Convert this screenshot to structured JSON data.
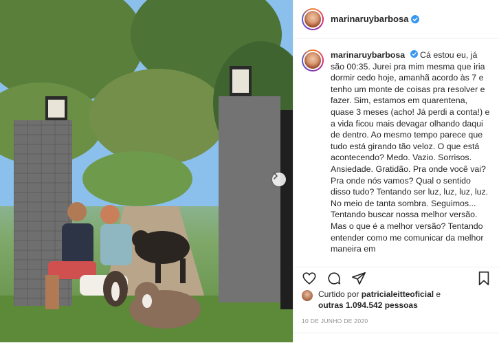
{
  "post": {
    "username": "marinaruybarbosa",
    "caption": "Cá estou eu, já são 00:35. Jurei pra mim mesma que iria dormir cedo hoje, amanhã acordo às 7 e tenho um monte de coisas pra resolver e fazer. Sim, estamos em quarentena, quase 3 meses (acho! Já perdi a conta!) e a vida ficou mais devagar olhando daqui de dentro. Ao mesmo tempo parece que tudo está girando tão veloz. O que está acontecendo? Medo. Vazio. Sorrisos. Ansiedade. Gratidão. Pra onde você vai? Pra onde nós vamos? Qual o sentido disso tudo? Tentando ser luz, luz, luz, luz. No meio de tanta sombra. Seguimos... Tentando buscar nossa melhor versão. Mas o que é a melhor versão? Tentando entender como me comunicar da melhor maneira em",
    "likes_prefix": "Curtido por ",
    "likes_user": "patricialeitteoficial",
    "likes_mid": " e",
    "likes_others": "outras 1.094.542 pessoas",
    "date": "10 DE JUNHO DE 2020"
  },
  "icons": {
    "verified": "verified-badge-icon",
    "like": "heart-icon",
    "comment": "comment-icon",
    "share": "share-icon",
    "save": "bookmark-icon",
    "next": "chevron-right-icon"
  },
  "colors": {
    "verified": "#3897f0",
    "text": "#262626",
    "muted": "#8e8e8e"
  }
}
